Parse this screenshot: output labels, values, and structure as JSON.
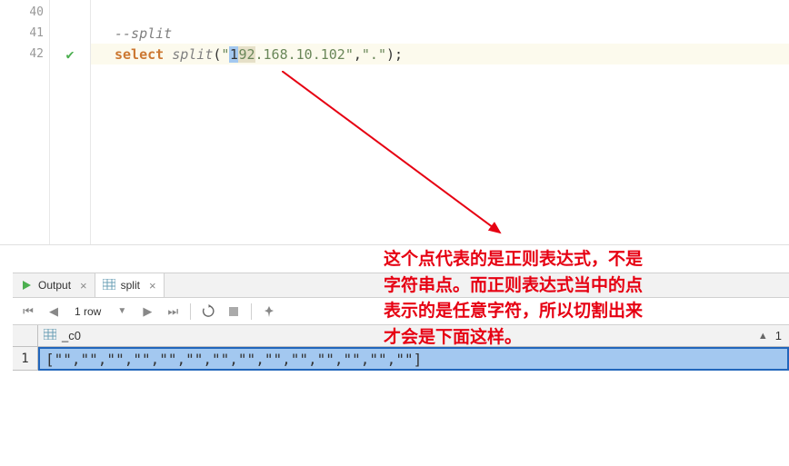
{
  "editor": {
    "lines": [
      {
        "num": "40",
        "content": ""
      },
      {
        "num": "41",
        "comment": "--split"
      },
      {
        "num": "42",
        "marker": "check",
        "highlight": true,
        "kw": "select",
        "fn": "split",
        "lp": "(",
        "q1": "\"",
        "sel": "1",
        "after_sel": "92",
        "rest_str": ".168.10.102",
        "q2": "\"",
        "comma": ",",
        "arg2": "\".\"",
        "rp": ")",
        "semi": ";"
      }
    ]
  },
  "annotation": {
    "line1": "这个点代表的是正则表达式，不是",
    "line2": "字符串点。而正则表达式当中的点",
    "line3": "表示的是任意字符，所以切割出来",
    "line4": "才会是下面这样。"
  },
  "tabs": {
    "output": {
      "label": "Output"
    },
    "split": {
      "label": "split"
    }
  },
  "toolbar": {
    "rows_text": "1 row"
  },
  "result": {
    "col_header": "_c0",
    "col_sort_num": "1",
    "row_num": "1",
    "cell_value": "[\"\",\"\",\"\",\"\",\"\",\"\",\"\",\"\",\"\",\"\",\"\",\"\",\"\",\"\"]"
  }
}
